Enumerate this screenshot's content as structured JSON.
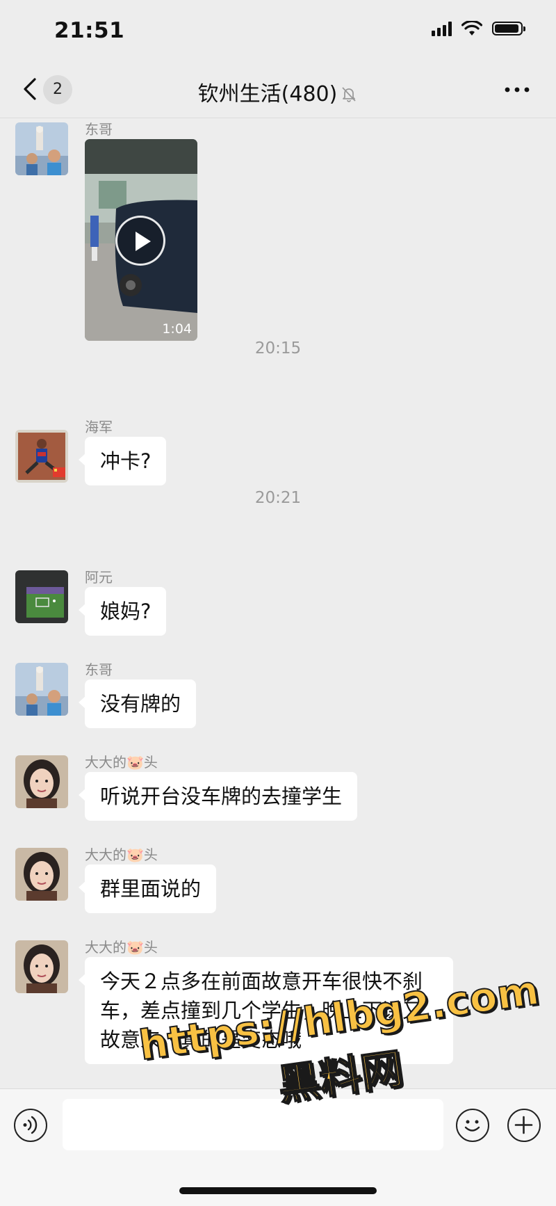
{
  "status_bar": {
    "time": "21:51"
  },
  "nav": {
    "badge": "2",
    "title": "钦州生活(480)"
  },
  "messages": [
    {
      "sender": "东哥",
      "kind": "video",
      "duration": "1:04"
    },
    {
      "timestamp": "20:15"
    },
    {
      "sender": "海军",
      "text": "冲卡?"
    },
    {
      "timestamp": "20:21"
    },
    {
      "sender": "阿元",
      "text": "娘妈?"
    },
    {
      "sender": "东哥",
      "text": "没有牌的"
    },
    {
      "sender": "大大的🐷头",
      "text": "听说开台没车牌的去撞学生"
    },
    {
      "sender": "大大的🐷头",
      "text": "群里面说的"
    },
    {
      "sender": "大大的🐷头",
      "text": "今天２点多在前面故意开车很快不刹车，差点撞到几个学生，晚上下课又故意来，真的是变态哦"
    }
  ],
  "watermark": {
    "url": "https://hlbg2.com",
    "name": "黑料网"
  },
  "colors": {
    "background": "#ededed",
    "bubble": "#ffffff",
    "watermark": "#f8c143"
  }
}
